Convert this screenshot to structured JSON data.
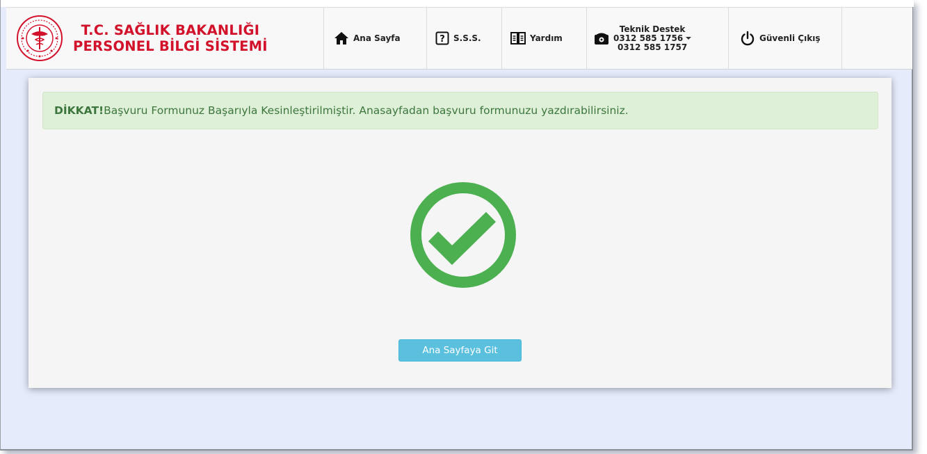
{
  "header": {
    "title_line1": "T.C. SAĞLIK BAKANLIĞI",
    "title_line2": "PERSONEL BİLGİ SİSTEMİ",
    "logo_icon": "ministry-emblem-icon"
  },
  "nav": {
    "home": {
      "label": "Ana Sayfa",
      "icon": "home-icon"
    },
    "faq": {
      "label": "S.S.S.",
      "icon": "question-icon"
    },
    "help": {
      "label": "Yardım",
      "icon": "book-icon"
    },
    "support": {
      "title": "Teknik Destek",
      "phone1": "0312 585 1756",
      "phone2": "0312 585 1757",
      "icon": "phone-icon"
    },
    "logout": {
      "label": "Güvenli Çıkış",
      "icon": "power-icon"
    }
  },
  "alert": {
    "strong": "DİKKAT!",
    "message": "Başvuru Formunuz Başarıyla Kesinleştirilmiştir. Anasayfadan başvuru formunuzu yazdırabilirsiniz."
  },
  "success_icon": "check-circle-icon",
  "button": {
    "label": "Ana Sayfaya Git"
  },
  "colors": {
    "brand_red": "#d2112a",
    "success_green": "#4caf50",
    "alert_bg": "#dff0d8",
    "alert_text": "#3c763d",
    "button_bg": "#5bc0de"
  }
}
